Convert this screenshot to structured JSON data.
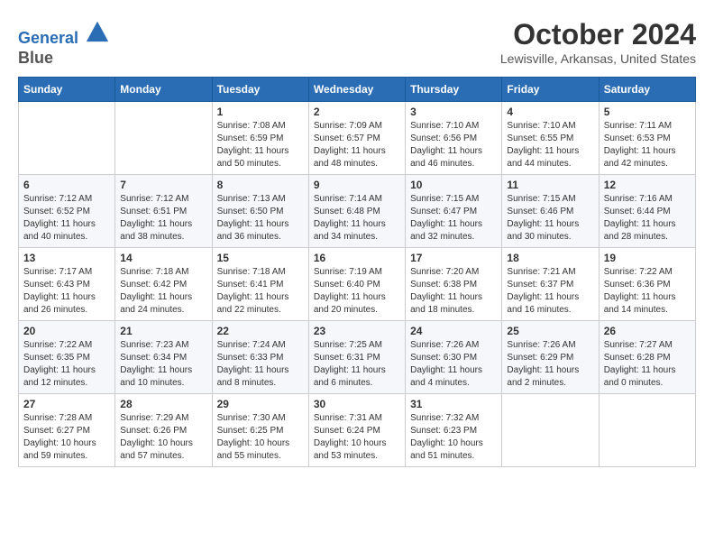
{
  "header": {
    "logo_line1": "General",
    "logo_line2": "Blue",
    "month": "October 2024",
    "location": "Lewisville, Arkansas, United States"
  },
  "weekdays": [
    "Sunday",
    "Monday",
    "Tuesday",
    "Wednesday",
    "Thursday",
    "Friday",
    "Saturday"
  ],
  "weeks": [
    [
      {
        "day": "",
        "info": ""
      },
      {
        "day": "",
        "info": ""
      },
      {
        "day": "1",
        "info": "Sunrise: 7:08 AM\nSunset: 6:59 PM\nDaylight: 11 hours and 50 minutes."
      },
      {
        "day": "2",
        "info": "Sunrise: 7:09 AM\nSunset: 6:57 PM\nDaylight: 11 hours and 48 minutes."
      },
      {
        "day": "3",
        "info": "Sunrise: 7:10 AM\nSunset: 6:56 PM\nDaylight: 11 hours and 46 minutes."
      },
      {
        "day": "4",
        "info": "Sunrise: 7:10 AM\nSunset: 6:55 PM\nDaylight: 11 hours and 44 minutes."
      },
      {
        "day": "5",
        "info": "Sunrise: 7:11 AM\nSunset: 6:53 PM\nDaylight: 11 hours and 42 minutes."
      }
    ],
    [
      {
        "day": "6",
        "info": "Sunrise: 7:12 AM\nSunset: 6:52 PM\nDaylight: 11 hours and 40 minutes."
      },
      {
        "day": "7",
        "info": "Sunrise: 7:12 AM\nSunset: 6:51 PM\nDaylight: 11 hours and 38 minutes."
      },
      {
        "day": "8",
        "info": "Sunrise: 7:13 AM\nSunset: 6:50 PM\nDaylight: 11 hours and 36 minutes."
      },
      {
        "day": "9",
        "info": "Sunrise: 7:14 AM\nSunset: 6:48 PM\nDaylight: 11 hours and 34 minutes."
      },
      {
        "day": "10",
        "info": "Sunrise: 7:15 AM\nSunset: 6:47 PM\nDaylight: 11 hours and 32 minutes."
      },
      {
        "day": "11",
        "info": "Sunrise: 7:15 AM\nSunset: 6:46 PM\nDaylight: 11 hours and 30 minutes."
      },
      {
        "day": "12",
        "info": "Sunrise: 7:16 AM\nSunset: 6:44 PM\nDaylight: 11 hours and 28 minutes."
      }
    ],
    [
      {
        "day": "13",
        "info": "Sunrise: 7:17 AM\nSunset: 6:43 PM\nDaylight: 11 hours and 26 minutes."
      },
      {
        "day": "14",
        "info": "Sunrise: 7:18 AM\nSunset: 6:42 PM\nDaylight: 11 hours and 24 minutes."
      },
      {
        "day": "15",
        "info": "Sunrise: 7:18 AM\nSunset: 6:41 PM\nDaylight: 11 hours and 22 minutes."
      },
      {
        "day": "16",
        "info": "Sunrise: 7:19 AM\nSunset: 6:40 PM\nDaylight: 11 hours and 20 minutes."
      },
      {
        "day": "17",
        "info": "Sunrise: 7:20 AM\nSunset: 6:38 PM\nDaylight: 11 hours and 18 minutes."
      },
      {
        "day": "18",
        "info": "Sunrise: 7:21 AM\nSunset: 6:37 PM\nDaylight: 11 hours and 16 minutes."
      },
      {
        "day": "19",
        "info": "Sunrise: 7:22 AM\nSunset: 6:36 PM\nDaylight: 11 hours and 14 minutes."
      }
    ],
    [
      {
        "day": "20",
        "info": "Sunrise: 7:22 AM\nSunset: 6:35 PM\nDaylight: 11 hours and 12 minutes."
      },
      {
        "day": "21",
        "info": "Sunrise: 7:23 AM\nSunset: 6:34 PM\nDaylight: 11 hours and 10 minutes."
      },
      {
        "day": "22",
        "info": "Sunrise: 7:24 AM\nSunset: 6:33 PM\nDaylight: 11 hours and 8 minutes."
      },
      {
        "day": "23",
        "info": "Sunrise: 7:25 AM\nSunset: 6:31 PM\nDaylight: 11 hours and 6 minutes."
      },
      {
        "day": "24",
        "info": "Sunrise: 7:26 AM\nSunset: 6:30 PM\nDaylight: 11 hours and 4 minutes."
      },
      {
        "day": "25",
        "info": "Sunrise: 7:26 AM\nSunset: 6:29 PM\nDaylight: 11 hours and 2 minutes."
      },
      {
        "day": "26",
        "info": "Sunrise: 7:27 AM\nSunset: 6:28 PM\nDaylight: 11 hours and 0 minutes."
      }
    ],
    [
      {
        "day": "27",
        "info": "Sunrise: 7:28 AM\nSunset: 6:27 PM\nDaylight: 10 hours and 59 minutes."
      },
      {
        "day": "28",
        "info": "Sunrise: 7:29 AM\nSunset: 6:26 PM\nDaylight: 10 hours and 57 minutes."
      },
      {
        "day": "29",
        "info": "Sunrise: 7:30 AM\nSunset: 6:25 PM\nDaylight: 10 hours and 55 minutes."
      },
      {
        "day": "30",
        "info": "Sunrise: 7:31 AM\nSunset: 6:24 PM\nDaylight: 10 hours and 53 minutes."
      },
      {
        "day": "31",
        "info": "Sunrise: 7:32 AM\nSunset: 6:23 PM\nDaylight: 10 hours and 51 minutes."
      },
      {
        "day": "",
        "info": ""
      },
      {
        "day": "",
        "info": ""
      }
    ]
  ]
}
